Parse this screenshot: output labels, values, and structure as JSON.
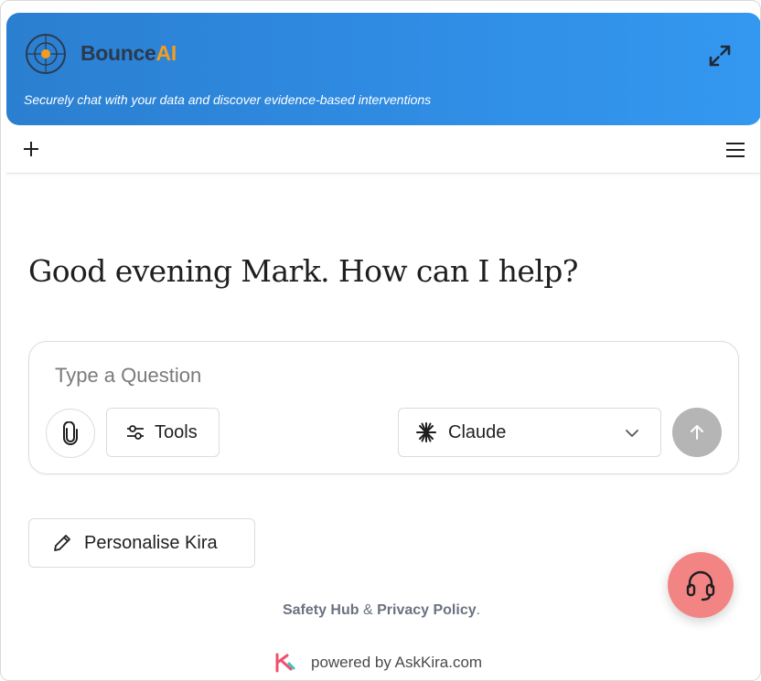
{
  "header": {
    "brand_prefix": "Bounce",
    "brand_suffix": "AI",
    "tagline": "Securely chat with your data and discover evidence-based interventions",
    "expand_icon": "expand-icon",
    "colors": {
      "gradient_start": "#2b7fd0",
      "gradient_end": "#3498f0",
      "brand_accent": "#f39c1f"
    }
  },
  "toolbar": {
    "new_chat_icon": "plus-icon",
    "menu_icon": "hamburger-menu-icon"
  },
  "main": {
    "greeting": "Good evening Mark. How can I help?",
    "composer": {
      "placeholder": "Type a Question",
      "attach_icon": "paperclip-icon",
      "tools_label": "Tools",
      "model_label": "Claude",
      "send_icon": "arrow-up-icon"
    },
    "personalise_label": "Personalise Kira"
  },
  "footer": {
    "safety_hub": "Safety Hub",
    "ampersand": "&",
    "privacy_policy": "Privacy Policy",
    "period": ".",
    "powered_by": "powered by AskKira.com"
  },
  "support_button": {
    "icon": "headset-icon",
    "color": "#f28484"
  }
}
